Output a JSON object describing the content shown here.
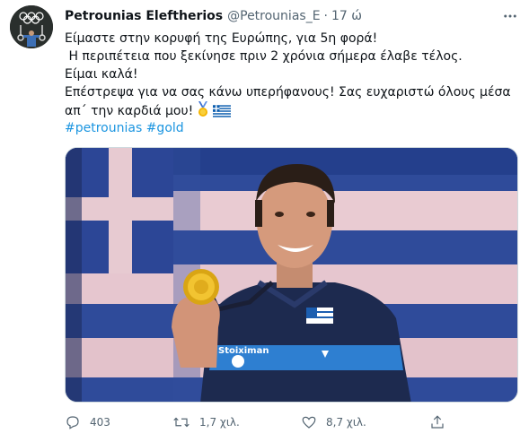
{
  "tweet": {
    "author": {
      "display_name": "Petrounias Eleftherios",
      "handle": "@Petrounias_E",
      "separator": "·",
      "time": "17 ώ"
    },
    "text_lines": [
      "Είμαστε στην κορυφή της Ευρώπης, για 5η φορά!",
      " Η περιπέτεια που ξεκίνησε πριν 2 χρόνια σήμερα έλαβε τέλος.",
      "Είμαι καλά!",
      "Επέστρεψα για να σας κάνω υπερήφανους! Σας ευχαριστώ όλους μέσα",
      "απ΄ την καρδιά μου!"
    ],
    "emojis": [
      "1st-place-medal",
      "flag-greece"
    ],
    "hashtags": [
      "#petrounias",
      "#gold"
    ],
    "media": {
      "type": "photo",
      "subject": "athlete with gold medal",
      "jacket_text": "Stoiximan"
    },
    "actions": {
      "reply_count": "403",
      "retweet_count": "1,7 χιλ.",
      "like_count": "8,7 χιλ."
    },
    "icons": [
      "reply-icon",
      "retweet-icon",
      "like-icon",
      "share-icon",
      "more-icon"
    ],
    "colors": {
      "link": "#1b95e0",
      "secondary_text": "#536471"
    }
  }
}
